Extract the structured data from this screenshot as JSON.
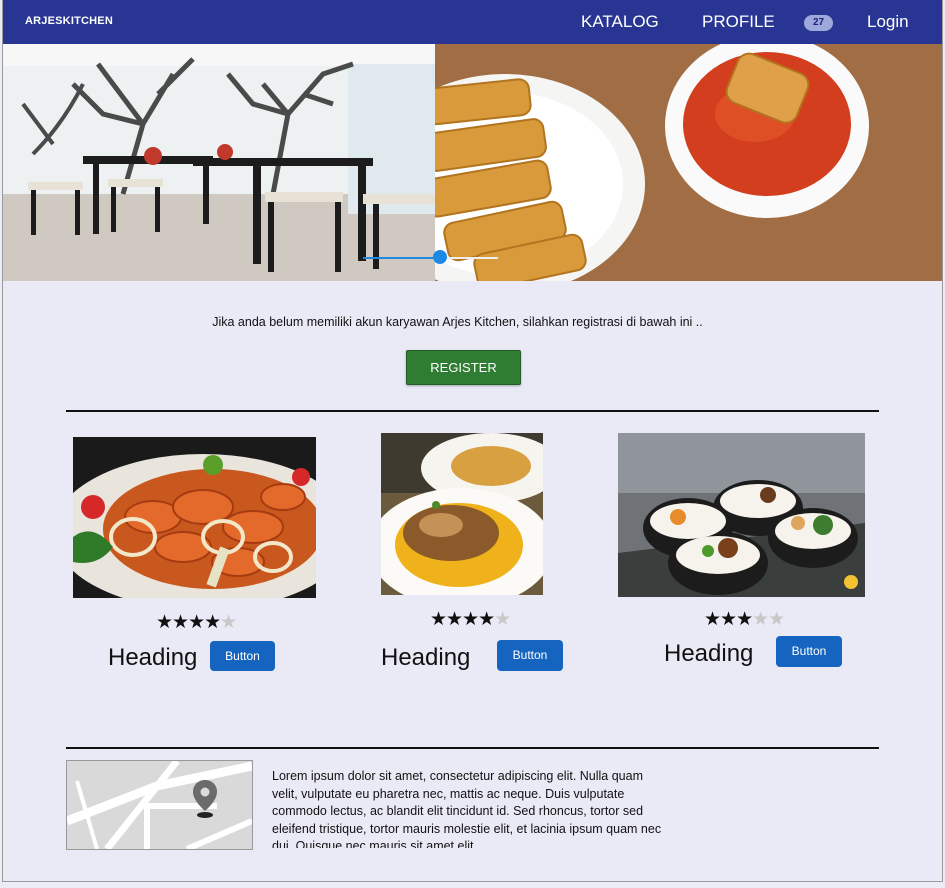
{
  "navbar": {
    "brand": "ARJESKITCHEN",
    "items": [
      "KATALOG",
      "PROFILE"
    ],
    "badge": "27",
    "login": "Login"
  },
  "carousel": {
    "slides": [
      "restaurant-interior-photo",
      "fried-sticks-with-sauce-photo"
    ],
    "position": 0.56
  },
  "register_section": {
    "message": "Jika anda belum memiliki akun karyawan Arjes Kitchen, silahkan registrasi di bawah ini ..",
    "button": "REGISTER"
  },
  "cards": [
    {
      "image": "shrimp-dish-photo",
      "rating": 4,
      "max": 5,
      "heading": "Heading",
      "button": "Button"
    },
    {
      "image": "rice-plate-photo",
      "rating": 4,
      "max": 5,
      "heading": "Heading",
      "button": "Button"
    },
    {
      "image": "rice-bowls-photo",
      "rating": 3,
      "max": 5,
      "heading": "Heading",
      "button": "Button"
    }
  ],
  "footer": {
    "map": "map-pin-icon",
    "text": "Lorem ipsum dolor sit amet, consectetur adipiscing elit. Nulla quam velit, vulputate eu pharetra nec, mattis ac neque. Duis vulputate commodo lectus, ac blandit elit tincidunt id. Sed rhoncus, tortor sed eleifend tristique, tortor mauris molestie elit, et lacinia ipsum quam nec dui. Quisque nec mauris sit amet elit"
  },
  "colors": {
    "navbar": "#283593",
    "register": "#2e7d32",
    "button": "#1565c0",
    "background": "#eaeaf7"
  }
}
